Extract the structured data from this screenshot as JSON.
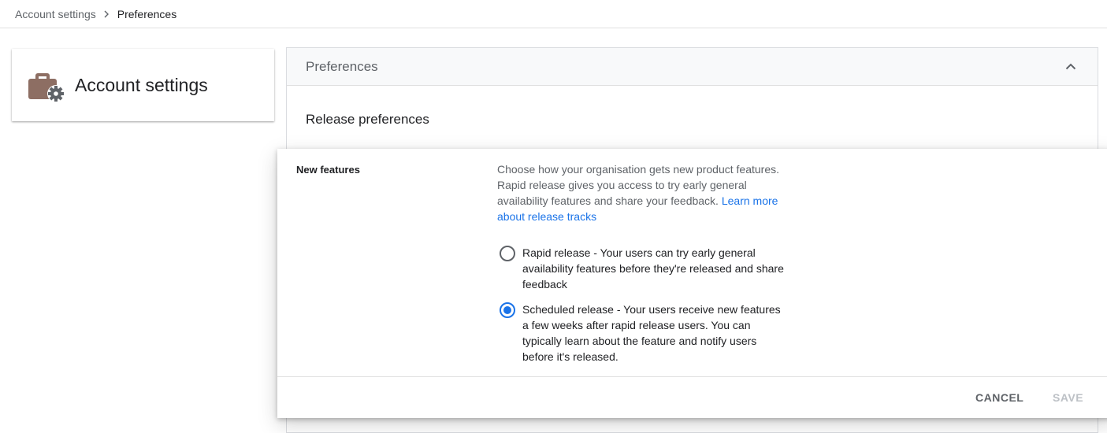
{
  "breadcrumb": {
    "parent": "Account settings",
    "current": "Preferences"
  },
  "app": {
    "title": "Account settings",
    "icon": "briefcase-gear-icon",
    "icon_color": "#8d6e63",
    "gear_color": "#5f6368"
  },
  "panel": {
    "title": "Preferences",
    "section_title": "Release preferences"
  },
  "new_features": {
    "label": "New features",
    "description": "Choose how your organisation gets new product features. Rapid release gives you access to try early general availability features and share your feedback.",
    "learn_more": "Learn more about release tracks",
    "options": [
      {
        "label": "Rapid release - Your users can try early general availability features before they're released and share feedback",
        "selected": false
      },
      {
        "label": "Scheduled release - Your users receive new features a few weeks after rapid release users. You can typically learn about the feature and notify users before it's released.",
        "selected": true
      }
    ]
  },
  "actions": {
    "cancel": "CANCEL",
    "save": "SAVE"
  },
  "colors": {
    "accent": "#1a73e8",
    "link": "#1a73e8",
    "disabled": "#bdc1c6"
  }
}
